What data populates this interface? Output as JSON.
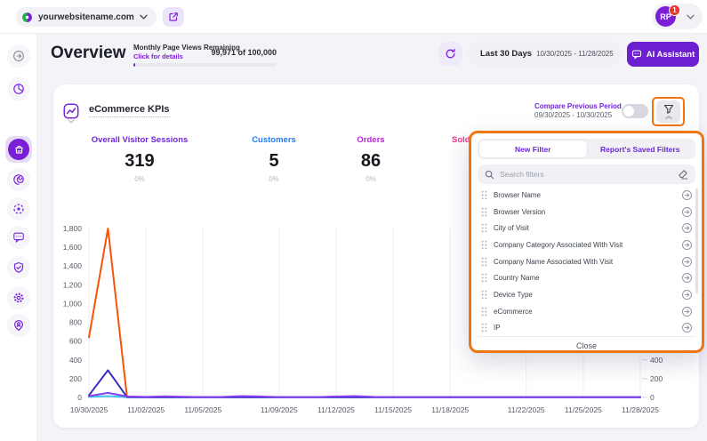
{
  "topbar": {
    "domain": "yourwebsitename.com",
    "avatar_initials": "RP",
    "notification_count": "1"
  },
  "header": {
    "title": "Overview",
    "pageviews_label": "Monthly Page Views Remaining",
    "pageviews_link": "Click for details",
    "pageviews_value": "99,971 of 100,000",
    "date_preset": "Last 30 Days",
    "date_range": "10/30/2025 - 11/28/2025",
    "ai_button_label": "AI Assistant"
  },
  "sidebar": {
    "icons": [
      "expand-arrow-icon",
      "dashboard-pie-icon",
      "ecommerce-bag-icon",
      "trends-swirl-icon",
      "audience-target-icon",
      "chat-bubble-icon",
      "security-shield-icon",
      "settings-gear-icon",
      "profile-pin-icon"
    ],
    "active_icon": "ecommerce-bag-icon"
  },
  "kpi_card": {
    "title": "eCommerce KPIs",
    "compare_label": "Compare Previous Period",
    "compare_range": "09/30/2025 - 10/30/2025",
    "compare_toggle_on": false,
    "kpis": [
      {
        "label": "Overall Visitor Sessions",
        "value": "319",
        "delta": "0%",
        "color": "#6d28d9"
      },
      {
        "label": "Customers",
        "value": "5",
        "delta": "0%",
        "color": "#1f7aff"
      },
      {
        "label": "Orders",
        "value": "86",
        "delta": "0%",
        "color": "#c221e0"
      },
      {
        "label": "Sold",
        "value": "",
        "delta": "",
        "color": "#f7318c"
      }
    ]
  },
  "filter_panel": {
    "tabs": [
      {
        "label": "New Filter",
        "active": true
      },
      {
        "label": "Report's Saved Filters",
        "active": false
      }
    ],
    "search_placeholder": "Search filters",
    "items": [
      "Browser Name",
      "Browser Version",
      "City of Visit",
      "Company Category Associated With Visit",
      "Company Name Associated With Visit",
      "Country Name",
      "Device Type",
      "eCommerce",
      "IP"
    ],
    "close_label": "Close"
  },
  "annotation_color": "#ee7612",
  "chart_data": {
    "type": "line",
    "title": "",
    "grid": "vertical",
    "days_total": 29,
    "x_tick_labels": [
      "10/30/2025",
      "11/02/2025",
      "11/05/2025",
      "11/09/2025",
      "11/12/2025",
      "11/15/2025",
      "11/18/2025",
      "11/22/2025",
      "11/25/2025",
      "11/28/2025"
    ],
    "x_tick_days": [
      0,
      3,
      6,
      10,
      13,
      16,
      19,
      23,
      26,
      29
    ],
    "y_left": {
      "min": 0,
      "max": 1800,
      "step": 200
    },
    "y_right_visible_ticks": [
      400,
      200,
      0
    ],
    "series": [
      {
        "name": "orange",
        "color": "#f4540a",
        "values": [
          640,
          1800,
          6,
          2,
          2,
          2,
          2,
          2,
          2,
          2,
          2,
          2,
          2,
          2,
          2,
          2,
          2,
          2,
          2,
          2,
          2,
          2,
          2,
          2,
          2,
          2,
          2,
          2,
          2,
          2
        ]
      },
      {
        "name": "blue",
        "color": "#41c3f5",
        "values": [
          6,
          14,
          2,
          1,
          1,
          1,
          1,
          1,
          1,
          1,
          1,
          1,
          1,
          1,
          1,
          1,
          1,
          1,
          1,
          1,
          1,
          1,
          1,
          1,
          1,
          1,
          1,
          1,
          1,
          1
        ]
      },
      {
        "name": "indigo",
        "color": "#3b2cc0",
        "values": [
          22,
          290,
          4,
          2,
          2,
          2,
          2,
          2,
          2,
          2,
          2,
          2,
          2,
          2,
          2,
          2,
          2,
          2,
          2,
          2,
          2,
          2,
          2,
          2,
          2,
          2,
          2,
          2,
          2,
          2
        ]
      },
      {
        "name": "violet",
        "color": "#8a3ff2",
        "values": [
          14,
          48,
          10,
          6,
          12,
          8,
          4,
          6,
          14,
          10,
          4,
          4,
          4,
          10,
          14,
          6,
          4,
          4,
          4,
          4,
          4,
          4,
          4,
          4,
          4,
          4,
          4,
          4,
          4,
          4
        ]
      }
    ]
  }
}
